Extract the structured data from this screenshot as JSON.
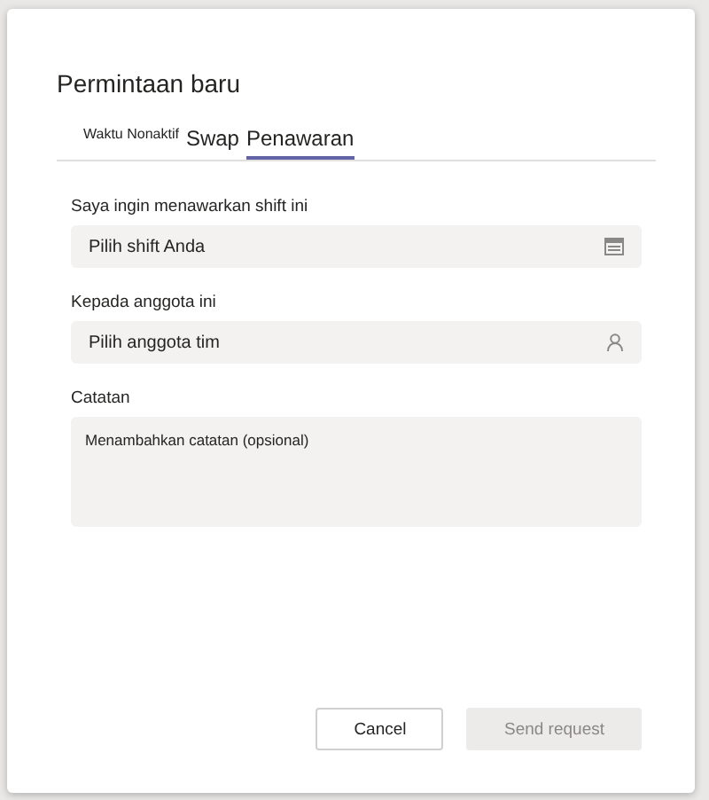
{
  "dialog": {
    "title": "Permintaan baru"
  },
  "tabs": [
    {
      "label": "Waktu Nonaktif",
      "selected": false,
      "kind": "small"
    },
    {
      "label": "Swap",
      "selected": false,
      "kind": "normal"
    },
    {
      "label": "Penawaran",
      "selected": true,
      "kind": "normal"
    }
  ],
  "fields": [
    {
      "label": "Saya ingin menawarkan shift ini",
      "placeholder": "Pilih shift Anda",
      "kind": "date"
    },
    {
      "label": "Kepada anggota ini",
      "placeholder": "Pilih anggota tim",
      "kind": "person"
    },
    {
      "label": "Catatan",
      "placeholder": "Menambahkan catatan (opsional)",
      "kind": "note"
    }
  ],
  "buttons": [
    {
      "label": "Cancel",
      "disabled": false
    },
    {
      "label": "Send request",
      "disabled": true
    }
  ]
}
